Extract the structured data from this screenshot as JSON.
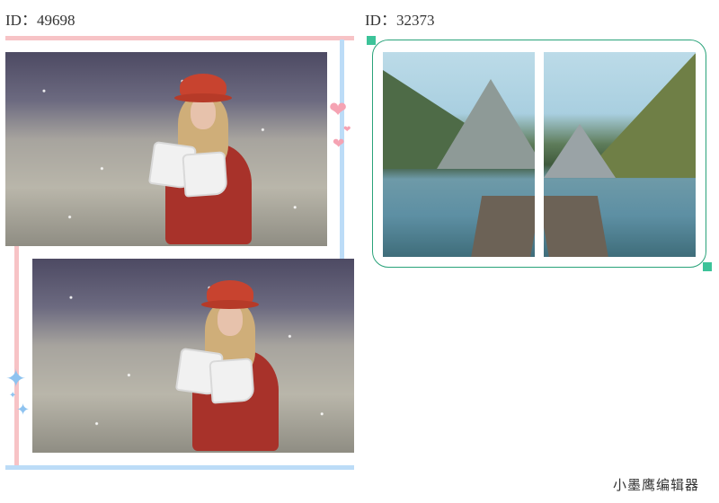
{
  "templates": [
    {
      "id_label": "ID：49698",
      "photo_count": 2,
      "colors": {
        "accent_pink": "#f7c3c6",
        "accent_blue": "#bcdcf7",
        "heart": "#f5a3b3",
        "star": "#8ec3f0"
      }
    },
    {
      "id_label": "ID：32373",
      "photo_count": 2,
      "colors": {
        "frame_green": "#2aa37a",
        "corner": "#3cc399"
      }
    }
  ],
  "decorations": {
    "heart_glyph": "❤",
    "star_glyph": "✦"
  },
  "watermark": "小墨鹰编辑器"
}
